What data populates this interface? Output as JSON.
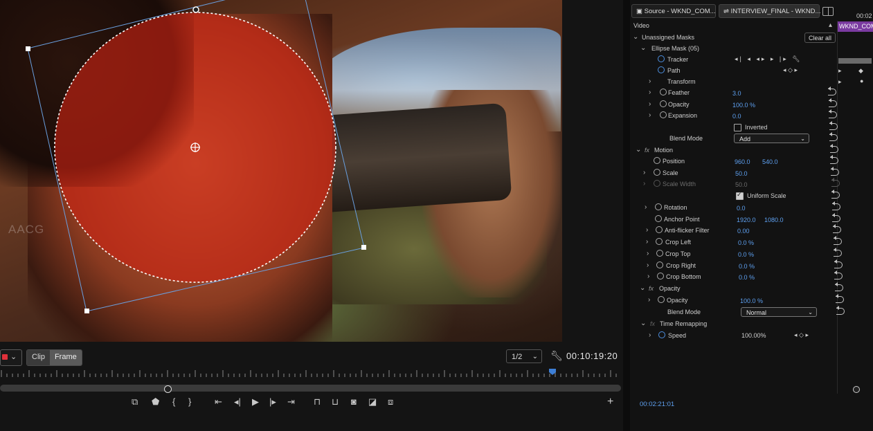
{
  "monitor": {
    "watermark": "AACG",
    "buttons": {
      "clip": "Clip",
      "frame": "Frame"
    },
    "resolution": "1/2",
    "timecode": "00:10:19:20",
    "transport_icons": [
      "export-frame-icon",
      "marker-icon",
      "mark-in-icon",
      "mark-out-icon",
      "go-to-in-icon",
      "step-back-icon",
      "play-icon",
      "step-forward-icon",
      "go-to-out-icon",
      "insert-icon",
      "overwrite-icon",
      "camera-icon",
      "compare-icon",
      "multicam-icon",
      "add-button-icon"
    ]
  },
  "panel": {
    "tabs": [
      "Source - WKND_COM...",
      "INTERVIEW_FINAL - WKND..."
    ],
    "timeline_time": "00:02",
    "clip_name": "WKND_COM",
    "section": "Video",
    "clear_all": "Clear all",
    "footer_time": "00:02:21:01",
    "rows": {
      "unassigned": "Unassigned Masks",
      "ellipse": "Ellipse Mask (05)",
      "tracker": "Tracker",
      "path": "Path",
      "transform": "Transform",
      "feather": {
        "label": "Feather",
        "value": "3.0"
      },
      "mask_opacity": {
        "label": "Opacity",
        "value": "100.0 %"
      },
      "expansion": {
        "label": "Expansion",
        "value": "0.0"
      },
      "inverted": "Inverted",
      "blend1": {
        "label": "Blend Mode",
        "value": "Add"
      },
      "motion": "Motion",
      "position": {
        "label": "Position",
        "x": "960.0",
        "y": "540.0"
      },
      "scale": {
        "label": "Scale",
        "value": "50.0"
      },
      "scale_width": {
        "label": "Scale Width",
        "value": "50.0"
      },
      "uniform": "Uniform Scale",
      "rotation": {
        "label": "Rotation",
        "value": "0.0"
      },
      "anchor": {
        "label": "Anchor Point",
        "x": "1920.0",
        "y": "1080.0"
      },
      "antiflicker": {
        "label": "Anti-flicker Filter",
        "value": "0.00"
      },
      "crop_left": {
        "label": "Crop Left",
        "value": "0.0 %"
      },
      "crop_top": {
        "label": "Crop Top",
        "value": "0.0 %"
      },
      "crop_right": {
        "label": "Crop Right",
        "value": "0.0 %"
      },
      "crop_bottom": {
        "label": "Crop Bottom",
        "value": "0.0 %"
      },
      "opacity_fx": "Opacity",
      "opacity": {
        "label": "Opacity",
        "value": "100.0 %"
      },
      "blend2": {
        "label": "Blend Mode",
        "value": "Normal"
      },
      "time_remap": "Time Remapping",
      "speed": {
        "label": "Speed",
        "value": "100.00%"
      }
    },
    "fx_symbol": "fx"
  },
  "colors": {
    "accent_blue": "#3d7fd6",
    "mask_red": "#e0303a",
    "clip_purple": "#7a3aa0"
  }
}
